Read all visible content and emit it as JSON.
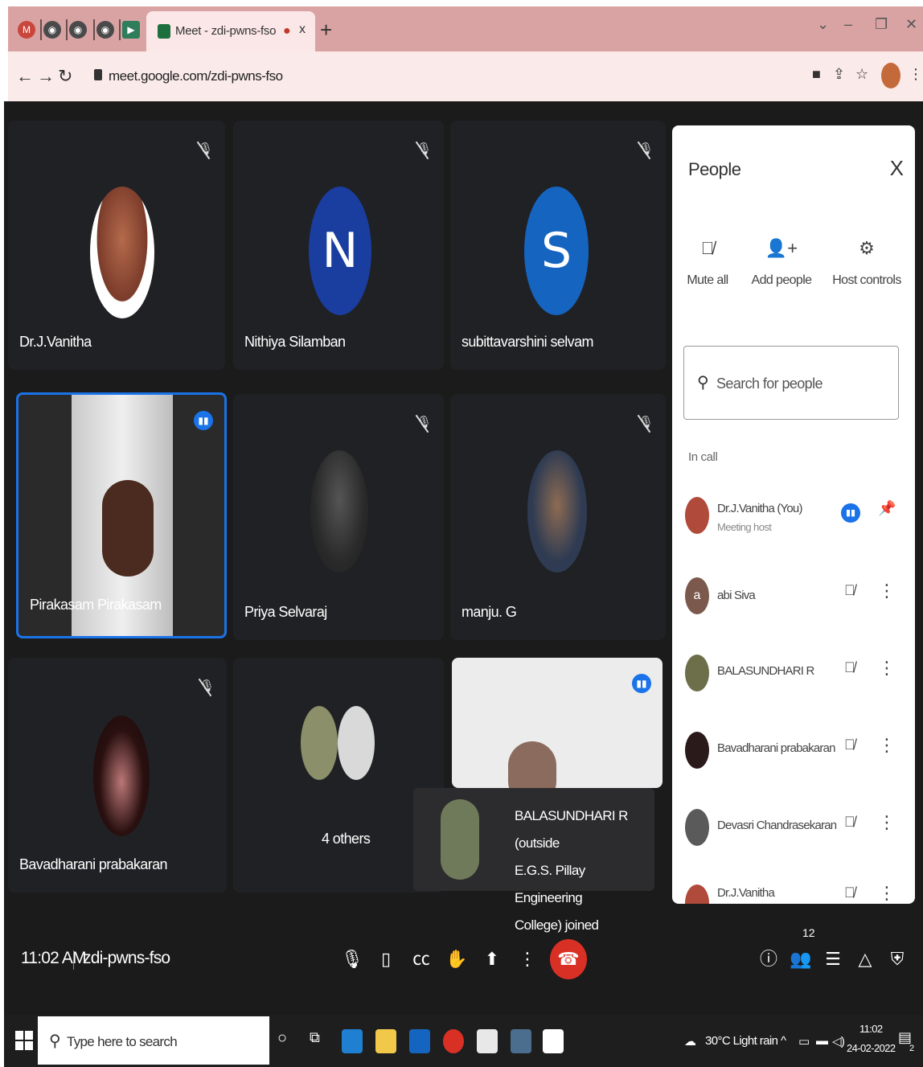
{
  "browser": {
    "tab_title": "Meet - zdi-pwns-fso",
    "url": "meet.google.com/zdi-pwns-fso",
    "new_tab": "+",
    "close_tab": "x"
  },
  "tiles": [
    {
      "name": "Dr.J.Vanitha"
    },
    {
      "name": "Nithiya Silamban",
      "initial": "N",
      "color": "#1a3da0"
    },
    {
      "name": "subittavarshini selvam",
      "initial": "S",
      "color": "#1565c0"
    },
    {
      "name": "Pirakasam Pirakasam"
    },
    {
      "name": "Priya Selvaraj"
    },
    {
      "name": "manju. G"
    },
    {
      "name": "Bavadharani prabakaran"
    },
    {
      "name": "4 others"
    }
  ],
  "toast": {
    "line1": "BALASUNDHARI R (outside",
    "line2": "E.G.S. Pillay Engineering",
    "line3": "College) joined"
  },
  "panel": {
    "title": "People",
    "close": "X",
    "actions": [
      "Mute all",
      "Add people",
      "Host controls"
    ],
    "search_placeholder": "Search for people",
    "section": "In call",
    "participants": [
      {
        "name": "Dr.J.Vanitha (You)",
        "sub": "Meeting host"
      },
      {
        "name": "abi Siva",
        "initial": "a"
      },
      {
        "name": "BALASUNDHARI R"
      },
      {
        "name": "Bavadharani prabakaran"
      },
      {
        "name": "Devasri Chandrasekaran"
      },
      {
        "name": "Dr.J.Vanitha"
      }
    ]
  },
  "bottom": {
    "time": "11:02 AM",
    "meeting_code": "zdi-pwns-fso",
    "people_count": "12"
  },
  "taskbar": {
    "search_text": "Type here to search",
    "weather": "30°C  Light rain",
    "clock_time": "11:02",
    "clock_date": "24-02-2022",
    "notifications": "2"
  },
  "colors": {
    "accent": "#1a73e8",
    "end_call": "#d93025",
    "tab_strip": "#d9a3a3"
  }
}
